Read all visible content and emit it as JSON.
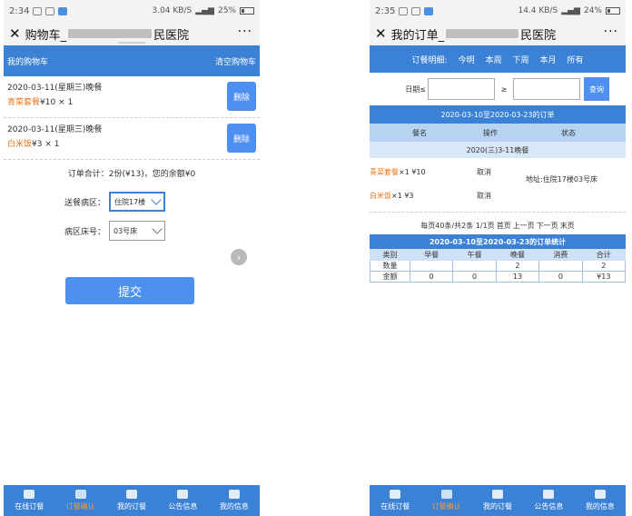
{
  "left": {
    "status": {
      "time": "2:34",
      "network": "3.04 KB/S",
      "battery": "25%"
    },
    "title_prefix": "购物车_",
    "title_suffix": "民医院",
    "more": "···",
    "header_title": "我的购物车",
    "clear_cart": "清空购物车",
    "items": [
      {
        "date": "2020-03-11(星期三)晚餐",
        "meal": "青菜套餐",
        "detail": "¥10 × 1",
        "delete": "删除"
      },
      {
        "date": "2020-03-11(星期三)晚餐",
        "meal": "白米饭",
        "detail": "¥3 × 1",
        "delete": "删除"
      }
    ],
    "summary": "订单合计：2份(¥13)，您的余额¥0",
    "ward_label": "送餐病区：",
    "ward_value": "住院17楼",
    "bed_label": "病区床号：",
    "bed_value": "03号床",
    "next": "›",
    "submit": "提交"
  },
  "right": {
    "status": {
      "time": "2:35",
      "network": "14.4 KB/S",
      "battery": "24%"
    },
    "title_prefix": "我的订单_",
    "title_suffix": "民医院",
    "more": "···",
    "filter": {
      "label": "订餐明细:",
      "options": [
        "今明",
        "本周",
        "下周",
        "本月",
        "所有"
      ]
    },
    "date_label": "日期≤",
    "date_ge": "≥",
    "query": "查询",
    "range": "2020-03-10至2020-03-23的订单",
    "columns": [
      "餐名",
      "操作",
      "状态"
    ],
    "day": "2020(三)3-11晚餐",
    "orders": [
      {
        "meal": "青菜套餐",
        "qty": "×1 ¥10",
        "action": "取消"
      },
      {
        "meal": "白米饭",
        "qty": "×1 ¥3",
        "action": "取消"
      }
    ],
    "address": "地址:住院17楼03号床",
    "pager": {
      "info": "每页40条/共2条 1/1页",
      "first": "首页",
      "prev": "上一页",
      "next": "下一页",
      "last": "末页"
    },
    "stats_title": "2020-03-10至2020-03-23的订单统计",
    "stats_header": [
      "类别",
      "早餐",
      "午餐",
      "晚餐",
      "消费",
      "合计"
    ],
    "stats_rows": [
      [
        "数量",
        "",
        "",
        "2",
        "",
        "2"
      ],
      [
        "金额",
        "0",
        "0",
        "13",
        "0",
        "¥13"
      ]
    ]
  },
  "tabs": [
    "在线订餐",
    "订餐确认",
    "我的订餐",
    "公告信息",
    "我的信息"
  ],
  "active_tab": 1,
  "colors": {
    "primary": "#3b82d6",
    "accent": "#e8751a",
    "active_tab": "#f39a3d"
  }
}
